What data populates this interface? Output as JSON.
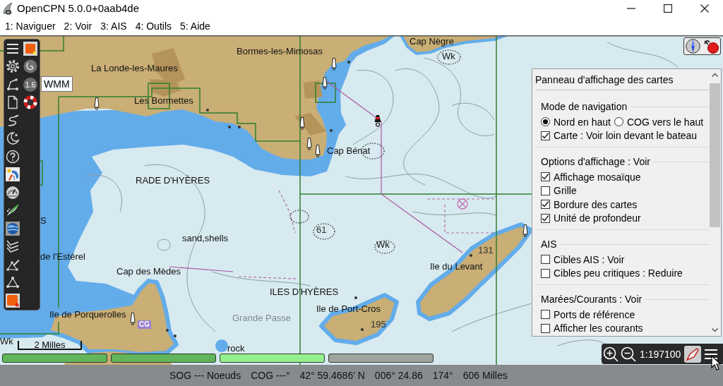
{
  "window": {
    "title": "OpenCPN 5.0.0+0aab4de"
  },
  "menu": [
    "1: Naviguer",
    "2: Voir",
    "3: AIS",
    "4: Outils",
    "5: Aide"
  ],
  "toolbar": {
    "badge": "1.6",
    "tooltip": "WMM"
  },
  "map": {
    "labels": [
      {
        "text": "Cap Nègre",
        "kind": "place"
      },
      {
        "text": "Bormes-les-Mimosas",
        "kind": "place"
      },
      {
        "text": "Wk",
        "kind": "place"
      },
      {
        "text": "La Londe-les-Maures",
        "kind": "place"
      },
      {
        "text": "Les Bormettes",
        "kind": "place"
      },
      {
        "text": "Cap Bénat",
        "kind": "place"
      },
      {
        "text": "RADE D'HYÈRES",
        "kind": "place"
      },
      {
        "text": "S",
        "kind": "place"
      },
      {
        "text": "61",
        "kind": "sounding"
      },
      {
        "text": "sand,shells",
        "kind": "place"
      },
      {
        "text": "Wk",
        "kind": "place"
      },
      {
        "text": "131",
        "kind": "sounding"
      },
      {
        "text": "de l'Estérel",
        "kind": "place"
      },
      {
        "text": "Ile du Levant",
        "kind": "place"
      },
      {
        "text": "Cap des Mèdes",
        "kind": "place"
      },
      {
        "text": "ILES D'HYÈRES",
        "kind": "place"
      },
      {
        "text": "Ile de Port-Cros",
        "kind": "place"
      },
      {
        "text": "Ile de Porquerolles",
        "kind": "place"
      },
      {
        "text": "Grande Passe",
        "kind": "passage"
      },
      {
        "text": "CG",
        "kind": "tag"
      },
      {
        "text": "195",
        "kind": "sounding"
      },
      {
        "text": "Wk",
        "kind": "place"
      },
      {
        "text": "rock",
        "kind": "place"
      }
    ],
    "scale": "2 Milles"
  },
  "panel": {
    "title": "Panneau d'affichage des cartes",
    "sections": [
      {
        "heading": "Mode de navigation",
        "options": [
          {
            "kind": "radio",
            "label": "Nord en haut",
            "selected": true
          },
          {
            "kind": "radio",
            "label": "COG vers le haut",
            "selected": false
          },
          {
            "kind": "checkbox",
            "label": "Carte : Voir loin devant le bateau",
            "checked": true
          }
        ]
      },
      {
        "heading": "Options d'affichage : Voir",
        "options": [
          {
            "kind": "checkbox",
            "label": "Affichage mosaïque",
            "checked": true
          },
          {
            "kind": "checkbox",
            "label": "Grille",
            "checked": false
          },
          {
            "kind": "checkbox",
            "label": "Bordure des cartes",
            "checked": true
          },
          {
            "kind": "checkbox",
            "label": "Unité de profondeur",
            "checked": true
          }
        ]
      },
      {
        "heading": "AIS",
        "options": [
          {
            "kind": "checkbox",
            "label": "Cibles AIS : Voir",
            "checked": false
          },
          {
            "kind": "checkbox",
            "label": "Cibles peu critiques : Reduire",
            "checked": false
          }
        ]
      },
      {
        "heading": "Marées/Courants : Voir",
        "options": [
          {
            "kind": "checkbox",
            "label": "Ports de référence",
            "checked": false
          },
          {
            "kind": "checkbox",
            "label": "Afficher les courants",
            "checked": false
          }
        ]
      }
    ]
  },
  "chart_bar": [
    {
      "color": "#62b55b"
    },
    {
      "color": "#62b55b"
    },
    {
      "color": "#93f08d"
    },
    {
      "color": "#9ea49e"
    }
  ],
  "zoom": {
    "scale": "1:197100"
  },
  "status_bar": [
    "SOG --- Noeuds",
    "COG ---°",
    "42° 59.4686' N",
    "006° 24.86",
    "174°",
    "606 Milles"
  ]
}
